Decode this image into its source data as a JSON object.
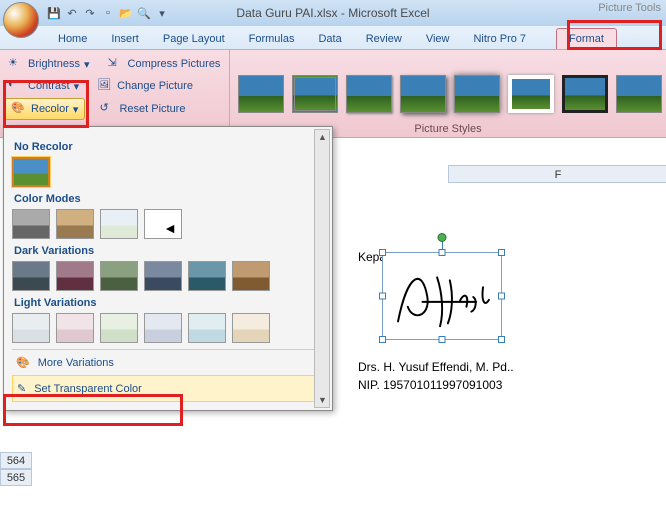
{
  "title": "Data Guru PAI.xlsx - Microsoft Excel",
  "picture_tools_label": "Picture Tools",
  "tabs": [
    "Home",
    "Insert",
    "Page Layout",
    "Formulas",
    "Data",
    "Review",
    "View",
    "Nitro Pro 7",
    "Format"
  ],
  "adjust": {
    "brightness": "Brightness",
    "contrast": "Contrast",
    "recolor": "Recolor",
    "compress": "Compress Pictures",
    "change": "Change Picture",
    "reset": "Reset Picture"
  },
  "styles_group_label": "Picture Styles",
  "recolor_menu": {
    "no_recolor": "No Recolor",
    "color_modes": "Color Modes",
    "dark_var": "Dark Variations",
    "light_var": "Light Variations",
    "more_var": "More Variations",
    "set_transparent": "Set Transparent Color"
  },
  "column_F": "F",
  "rows": [
    "564",
    "565"
  ],
  "cells": {
    "kepala": "Kepala",
    "name": "Drs. H. Yusuf Effendi, M. Pd..",
    "nip": "NIP. 195701011997091003"
  }
}
